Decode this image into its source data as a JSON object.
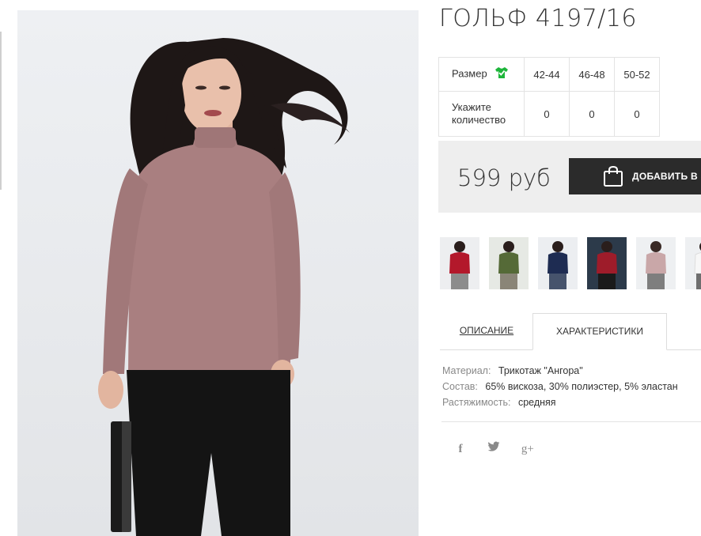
{
  "product": {
    "title": "ГОЛЬФ 4197/16",
    "price": "599 руб",
    "cart_button": "ДОБАВИТЬ В З"
  },
  "size_table": {
    "size_label": "Размер",
    "quantity_label": "Укажите количество",
    "sizes": [
      "42-44",
      "46-48",
      "50-52"
    ],
    "quantities": [
      "0",
      "0",
      "0"
    ],
    "tshirt_color": "#1db53a"
  },
  "thumbnails": [
    {
      "name": "red",
      "color": "#b3182b"
    },
    {
      "name": "olive",
      "color": "#556a37"
    },
    {
      "name": "navy",
      "color": "#1e2c52"
    },
    {
      "name": "burgundy",
      "color": "#9e1c2a"
    },
    {
      "name": "pink",
      "color": "#c9a7a8"
    },
    {
      "name": "white",
      "color": "#f2f2f2"
    }
  ],
  "tabs": {
    "description": "ОПИСАНИЕ",
    "characteristics": "ХАРАКТЕРИСТИКИ"
  },
  "specs": [
    {
      "label": "Материал:",
      "value": "Трикотаж \"Ангора\""
    },
    {
      "label": "Состав:",
      "value": "65% вискоза, 30% полиэстер, 5% эластан"
    },
    {
      "label": "Растяжимость:",
      "value": "средняя"
    }
  ],
  "social": {
    "facebook": "f",
    "twitter": "twitter-icon",
    "google_plus": "g+"
  },
  "colors": {
    "button_bg": "#2b2b2b",
    "price_bg": "#eeeeee",
    "sweater": "#a97f80"
  }
}
